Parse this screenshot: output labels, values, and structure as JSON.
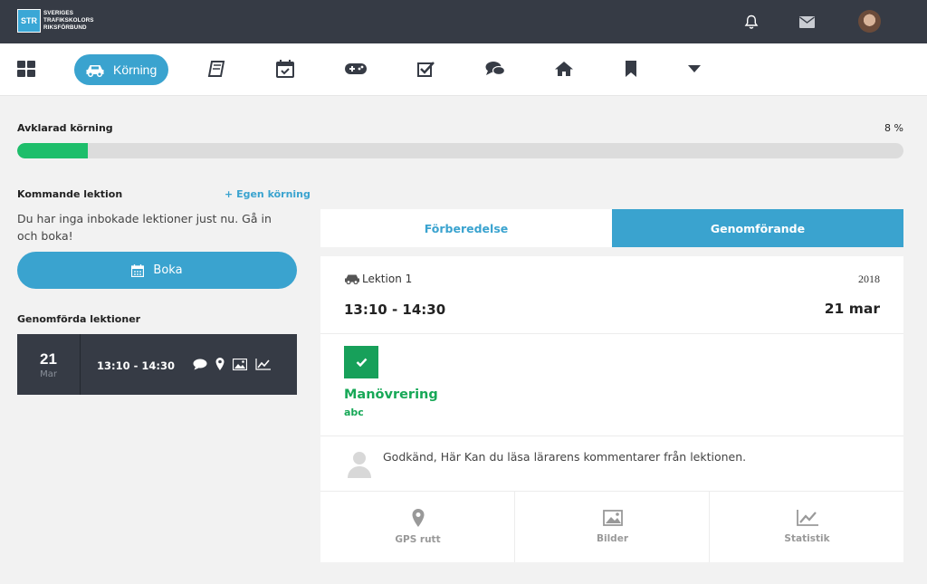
{
  "header": {
    "logo_abbr": "STR",
    "logo_lines": [
      "SVERIGES",
      "TRAFIKSKOLORS",
      "RIKSFÖRBUND"
    ],
    "icons": [
      "bell-icon",
      "envelope-icon"
    ]
  },
  "nav": {
    "active_label": "Körning",
    "items": [
      "dashboard-icon",
      "car-icon",
      "book-icon",
      "calendar-icon",
      "gamepad-icon",
      "checklist-icon",
      "chat-icon",
      "home-icon",
      "bookmark-icon",
      "caret-down-icon"
    ]
  },
  "progress": {
    "label": "Avklarad körning",
    "percent_text": "8 %",
    "value": 0.08
  },
  "upcoming": {
    "title": "Kommande lektion",
    "own_drive": "Egen körning",
    "empty_text": "Du har inga inbokade lektioner just nu. Gå in och boka!",
    "book_label": "Boka"
  },
  "completed": {
    "title": "Genomförda lektioner",
    "lesson": {
      "day": "21",
      "month": "Mar",
      "time": "13:10 - 14:30"
    }
  },
  "tabs": {
    "prep": "Förberedelse",
    "exec": "Genomförande"
  },
  "detail": {
    "lesson_label": "Lektion 1",
    "year": "2018",
    "time": "13:10 - 14:30",
    "date": "21 mar",
    "skill": "Manövrering",
    "skill_note": "abc",
    "comment": "Godkänd, Här Kan du läsa lärarens kommentarer från lektionen.",
    "footer": {
      "gps": "GPS rutt",
      "images": "Bilder",
      "stats": "Statistik"
    }
  },
  "colors": {
    "topbar": "#363b45",
    "accent": "#3aa3cf",
    "success": "#17a05a",
    "progress": "#1ebe6b"
  }
}
